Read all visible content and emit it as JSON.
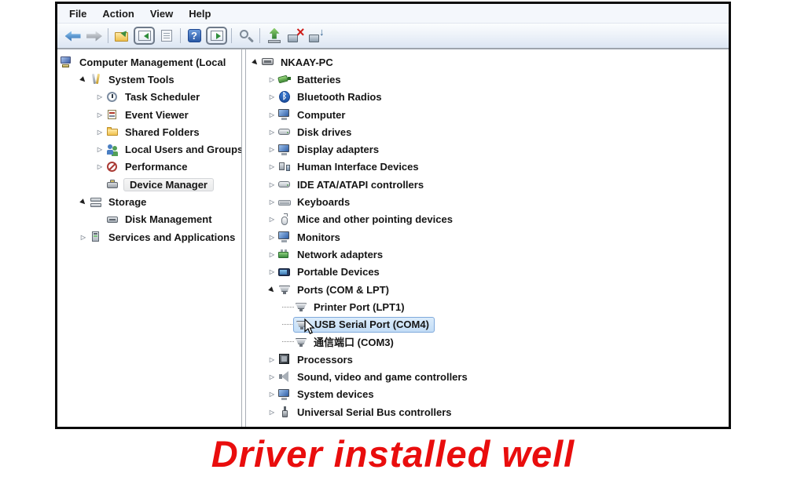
{
  "menu": {
    "items": [
      "File",
      "Action",
      "View",
      "Help"
    ]
  },
  "toolbar": {
    "buttons": [
      "back-arrow",
      "forward-arrow",
      "sep",
      "new-window-folder",
      "show-console-tree",
      "properties-list",
      "sep",
      "help",
      "show-action-pane",
      "sep",
      "search-computer",
      "sep",
      "update-driver",
      "uninstall-device",
      "scan-hardware-changes"
    ]
  },
  "console_tree": {
    "items": [
      {
        "label": "Computer Management (Local",
        "icon": "ic-mgmt",
        "level": 0,
        "exp": "omit"
      },
      {
        "label": "System Tools",
        "icon": "ic-tools",
        "level": 1,
        "exp": "expanded"
      },
      {
        "label": "Task Scheduler",
        "icon": "ic-clock",
        "level": 2,
        "exp": "collapsed"
      },
      {
        "label": "Event Viewer",
        "icon": "ic-event",
        "level": 2,
        "exp": "collapsed"
      },
      {
        "label": "Shared Folders",
        "icon": "ic-folder22",
        "level": 2,
        "exp": "collapsed"
      },
      {
        "label": "Local Users and Groups",
        "icon": "ic-users",
        "level": 2,
        "exp": "collapsed"
      },
      {
        "label": "Performance",
        "icon": "ic-perf",
        "level": 2,
        "exp": "collapsed"
      },
      {
        "label": "Device Manager",
        "icon": "ic-devmgr",
        "level": 2,
        "exp": "blank",
        "sel": "inactive"
      },
      {
        "label": "Storage",
        "icon": "ic-storage",
        "level": 1,
        "exp": "expanded"
      },
      {
        "label": "Disk Management",
        "icon": "ic-diskmgmt",
        "level": 2,
        "exp": "blank"
      },
      {
        "label": "Services and Applications",
        "icon": "ic-services",
        "level": 1,
        "exp": "collapsed"
      }
    ]
  },
  "device_tree": {
    "items": [
      {
        "label": "NKAAY-PC",
        "icon": "ic-nkaay",
        "level": 0,
        "exp": "expanded"
      },
      {
        "label": "Batteries",
        "icon": "ic-battery",
        "level": 1,
        "exp": "collapsed"
      },
      {
        "label": "Bluetooth Radios",
        "icon": "ic-bt",
        "level": 1,
        "exp": "collapsed"
      },
      {
        "label": "Computer",
        "icon": "ic-pc",
        "level": 1,
        "exp": "collapsed"
      },
      {
        "label": "Disk drives",
        "icon": "ic-drive",
        "level": 1,
        "exp": "collapsed"
      },
      {
        "label": "Display adapters",
        "icon": "ic-pc",
        "level": 1,
        "exp": "collapsed"
      },
      {
        "label": "Human Interface Devices",
        "icon": "ic-hid",
        "level": 1,
        "exp": "collapsed"
      },
      {
        "label": "IDE ATA/ATAPI controllers",
        "icon": "ic-drive",
        "level": 1,
        "exp": "collapsed"
      },
      {
        "label": "Keyboards",
        "icon": "ic-kbd",
        "level": 1,
        "exp": "collapsed"
      },
      {
        "label": "Mice and other pointing devices",
        "icon": "ic-mouse",
        "level": 1,
        "exp": "collapsed"
      },
      {
        "label": "Monitors",
        "icon": "ic-pc",
        "level": 1,
        "exp": "collapsed"
      },
      {
        "label": "Network adapters",
        "icon": "ic-net",
        "level": 1,
        "exp": "collapsed"
      },
      {
        "label": "Portable Devices",
        "icon": "ic-portable",
        "level": 1,
        "exp": "collapsed"
      },
      {
        "label": "Ports (COM & LPT)",
        "icon": "ic-port",
        "level": 1,
        "exp": "expanded"
      },
      {
        "label": "Printer Port (LPT1)",
        "icon": "ic-port",
        "level": 2,
        "exp": "blank",
        "dots": true
      },
      {
        "label": "USB Serial Port (COM4)",
        "icon": "ic-port",
        "level": 2,
        "exp": "blank",
        "dots": true,
        "sel": "active"
      },
      {
        "label": "通信端口 (COM3)",
        "icon": "ic-port",
        "level": 2,
        "exp": "blank",
        "dots": true
      },
      {
        "label": "Processors",
        "icon": "ic-cpu",
        "level": 1,
        "exp": "collapsed"
      },
      {
        "label": "Sound, video and game controllers",
        "icon": "ic-sound",
        "level": 1,
        "exp": "collapsed"
      },
      {
        "label": "System devices",
        "icon": "ic-pc",
        "level": 1,
        "exp": "collapsed"
      },
      {
        "label": "Universal Serial Bus controllers",
        "icon": "ic-usb",
        "level": 1,
        "exp": "collapsed"
      }
    ]
  },
  "selection": {
    "active_item": "USB Serial Port (COM4)",
    "inactive_item": "Device Manager",
    "active_bg": "#cfe3f8",
    "active_border": "#7fa9dc"
  },
  "caption": {
    "text": "Driver installed well",
    "color": "#e90d0d"
  }
}
